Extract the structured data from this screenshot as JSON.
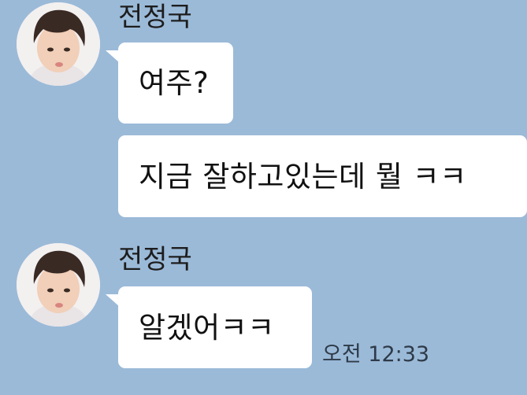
{
  "chat": {
    "groups": [
      {
        "sender": "전정국",
        "messages": [
          "여주?",
          "지금 잘하고있는데 뭘 ㅋㅋ"
        ]
      },
      {
        "sender": "전정국",
        "messages": [
          "알겠어ㅋㅋ"
        ],
        "time": "오전 12:33"
      }
    ]
  }
}
